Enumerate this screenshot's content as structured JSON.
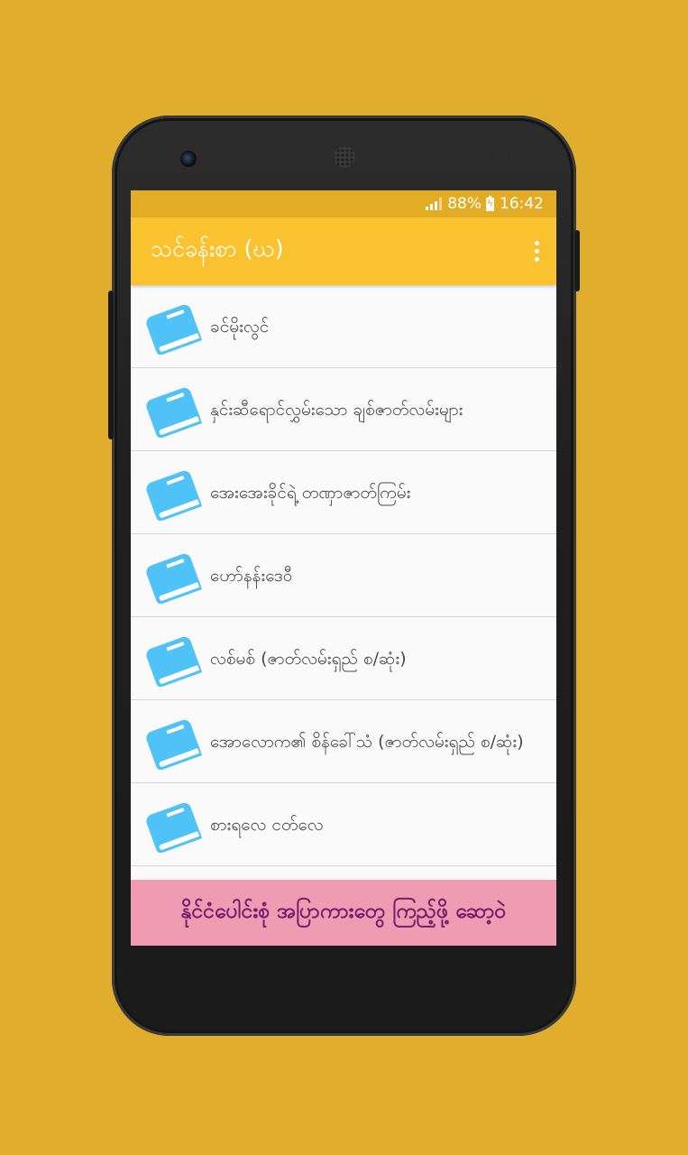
{
  "status_bar": {
    "battery_percent": "88%",
    "time": "16:42"
  },
  "app_bar": {
    "title": "သင်ခန်းစာ (ဃ)",
    "menu_icon": "more-vert-icon"
  },
  "list": {
    "items": [
      {
        "label": "ခင်မိုးလွင်",
        "icon": "book-icon"
      },
      {
        "label": "နှင်းဆီရောင်လွှမ်းသော ချစ်ဇာတ်လမ်းများ",
        "icon": "book-icon"
      },
      {
        "label": "အေးအေးခိုင်ရဲ့ တဏှာဇာတ်ကြမ်း",
        "icon": "book-icon"
      },
      {
        "label": "ဟော်နန်းဒေဝီ",
        "icon": "book-icon"
      },
      {
        "label": "လစ်မစ် (ဇာတ်လမ်းရှည် စ/ဆုံး)",
        "icon": "book-icon"
      },
      {
        "label": "အောလောက၏ စိန်ခေါ်သံ (ဇာတ်လမ်းရှည် စ/ဆုံး)",
        "icon": "book-icon"
      },
      {
        "label": "စားရလေ ငတ်လေ",
        "icon": "book-icon"
      }
    ]
  },
  "banner": {
    "text": "နိုင်ငံပေါင်းစုံ အပြာကားတွေ ကြည့်ဖို့ ဆော့ဝဲ"
  },
  "colors": {
    "background": "#e0ae2c",
    "status_bar": "#e2ad25",
    "app_bar": "#fbc230",
    "book_icon": "#4fc3f7",
    "banner_bg": "#f09bb2",
    "banner_text": "#7a1a6a"
  }
}
